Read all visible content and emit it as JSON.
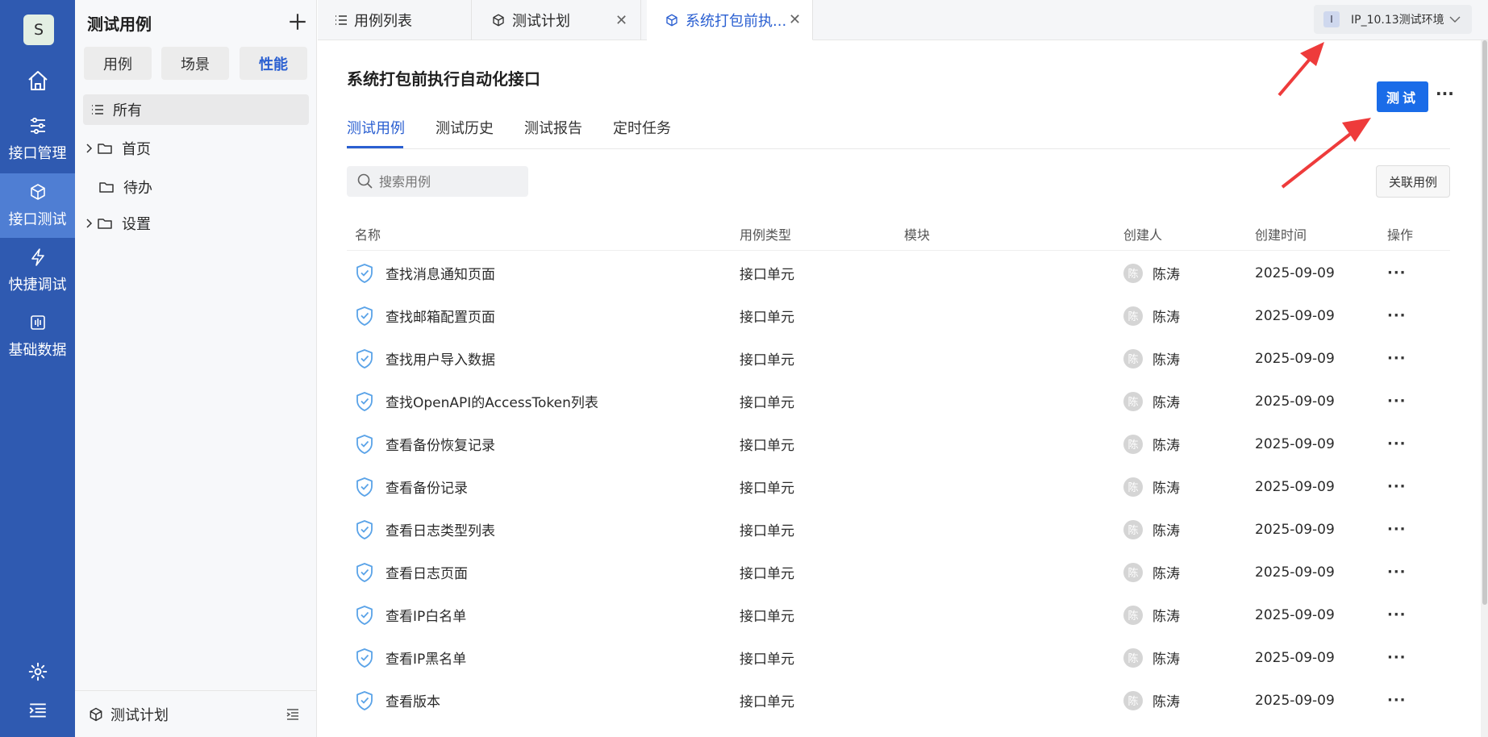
{
  "nav": {
    "avatar_letter": "S",
    "items": [
      {
        "label": "接口管理",
        "icon": "sliders-icon"
      },
      {
        "label": "接口测试",
        "icon": "cube-icon",
        "active": true
      },
      {
        "label": "快捷调试",
        "icon": "lightning-icon"
      },
      {
        "label": "基础数据",
        "icon": "data-icon"
      }
    ]
  },
  "tree": {
    "title": "测试用例",
    "segments": [
      "用例",
      "场景",
      "性能"
    ],
    "active_segment": "性能",
    "all_label": "所有",
    "nodes": [
      {
        "label": "首页",
        "expandable": true
      },
      {
        "label": "待办",
        "expandable": false
      },
      {
        "label": "设置",
        "expandable": true
      }
    ],
    "footer_label": "测试计划"
  },
  "tabs": [
    {
      "label": "用例列表",
      "closable": false
    },
    {
      "label": "测试计划",
      "closable": true
    },
    {
      "label": "系统打包前执...",
      "closable": true,
      "active": true
    }
  ],
  "env": {
    "badge": "I",
    "label": "IP_10.13测试环境"
  },
  "main": {
    "title": "系统打包前执行自动化接口",
    "test_button": "测试",
    "more": "···",
    "subtabs": [
      "测试用例",
      "测试历史",
      "测试报告",
      "定时任务"
    ],
    "search_placeholder": "搜索用例",
    "link_button": "关联用例",
    "columns": [
      "名称",
      "用例类型",
      "模块",
      "创建人",
      "创建时间",
      "操作"
    ],
    "rows": [
      {
        "name": "查找消息通知页面",
        "type": "接口单元",
        "module": "",
        "creator": "陈涛",
        "avatar": "陈",
        "date": "2025-09-09"
      },
      {
        "name": "查找邮箱配置页面",
        "type": "接口单元",
        "module": "",
        "creator": "陈涛",
        "avatar": "陈",
        "date": "2025-09-09"
      },
      {
        "name": "查找用户导入数据",
        "type": "接口单元",
        "module": "",
        "creator": "陈涛",
        "avatar": "陈",
        "date": "2025-09-09"
      },
      {
        "name": "查找OpenAPI的AccessToken列表",
        "type": "接口单元",
        "module": "",
        "creator": "陈涛",
        "avatar": "陈",
        "date": "2025-09-09"
      },
      {
        "name": "查看备份恢复记录",
        "type": "接口单元",
        "module": "",
        "creator": "陈涛",
        "avatar": "陈",
        "date": "2025-09-09"
      },
      {
        "name": "查看备份记录",
        "type": "接口单元",
        "module": "",
        "creator": "陈涛",
        "avatar": "陈",
        "date": "2025-09-09"
      },
      {
        "name": "查看日志类型列表",
        "type": "接口单元",
        "module": "",
        "creator": "陈涛",
        "avatar": "陈",
        "date": "2025-09-09"
      },
      {
        "name": "查看日志页面",
        "type": "接口单元",
        "module": "",
        "creator": "陈涛",
        "avatar": "陈",
        "date": "2025-09-09"
      },
      {
        "name": "查看IP白名单",
        "type": "接口单元",
        "module": "",
        "creator": "陈涛",
        "avatar": "陈",
        "date": "2025-09-09"
      },
      {
        "name": "查看IP黑名单",
        "type": "接口单元",
        "module": "",
        "creator": "陈涛",
        "avatar": "陈",
        "date": "2025-09-09"
      },
      {
        "name": "查看版本",
        "type": "接口单元",
        "module": "",
        "creator": "陈涛",
        "avatar": "陈",
        "date": "2025-09-09"
      }
    ],
    "row_ops": "···"
  },
  "colors": {
    "nav_bg": "#2f5ab1",
    "nav_active": "#4f7ed3",
    "accent": "#1a6ce8",
    "link": "#2a5fd1",
    "arrow": "#ee3b3b"
  }
}
